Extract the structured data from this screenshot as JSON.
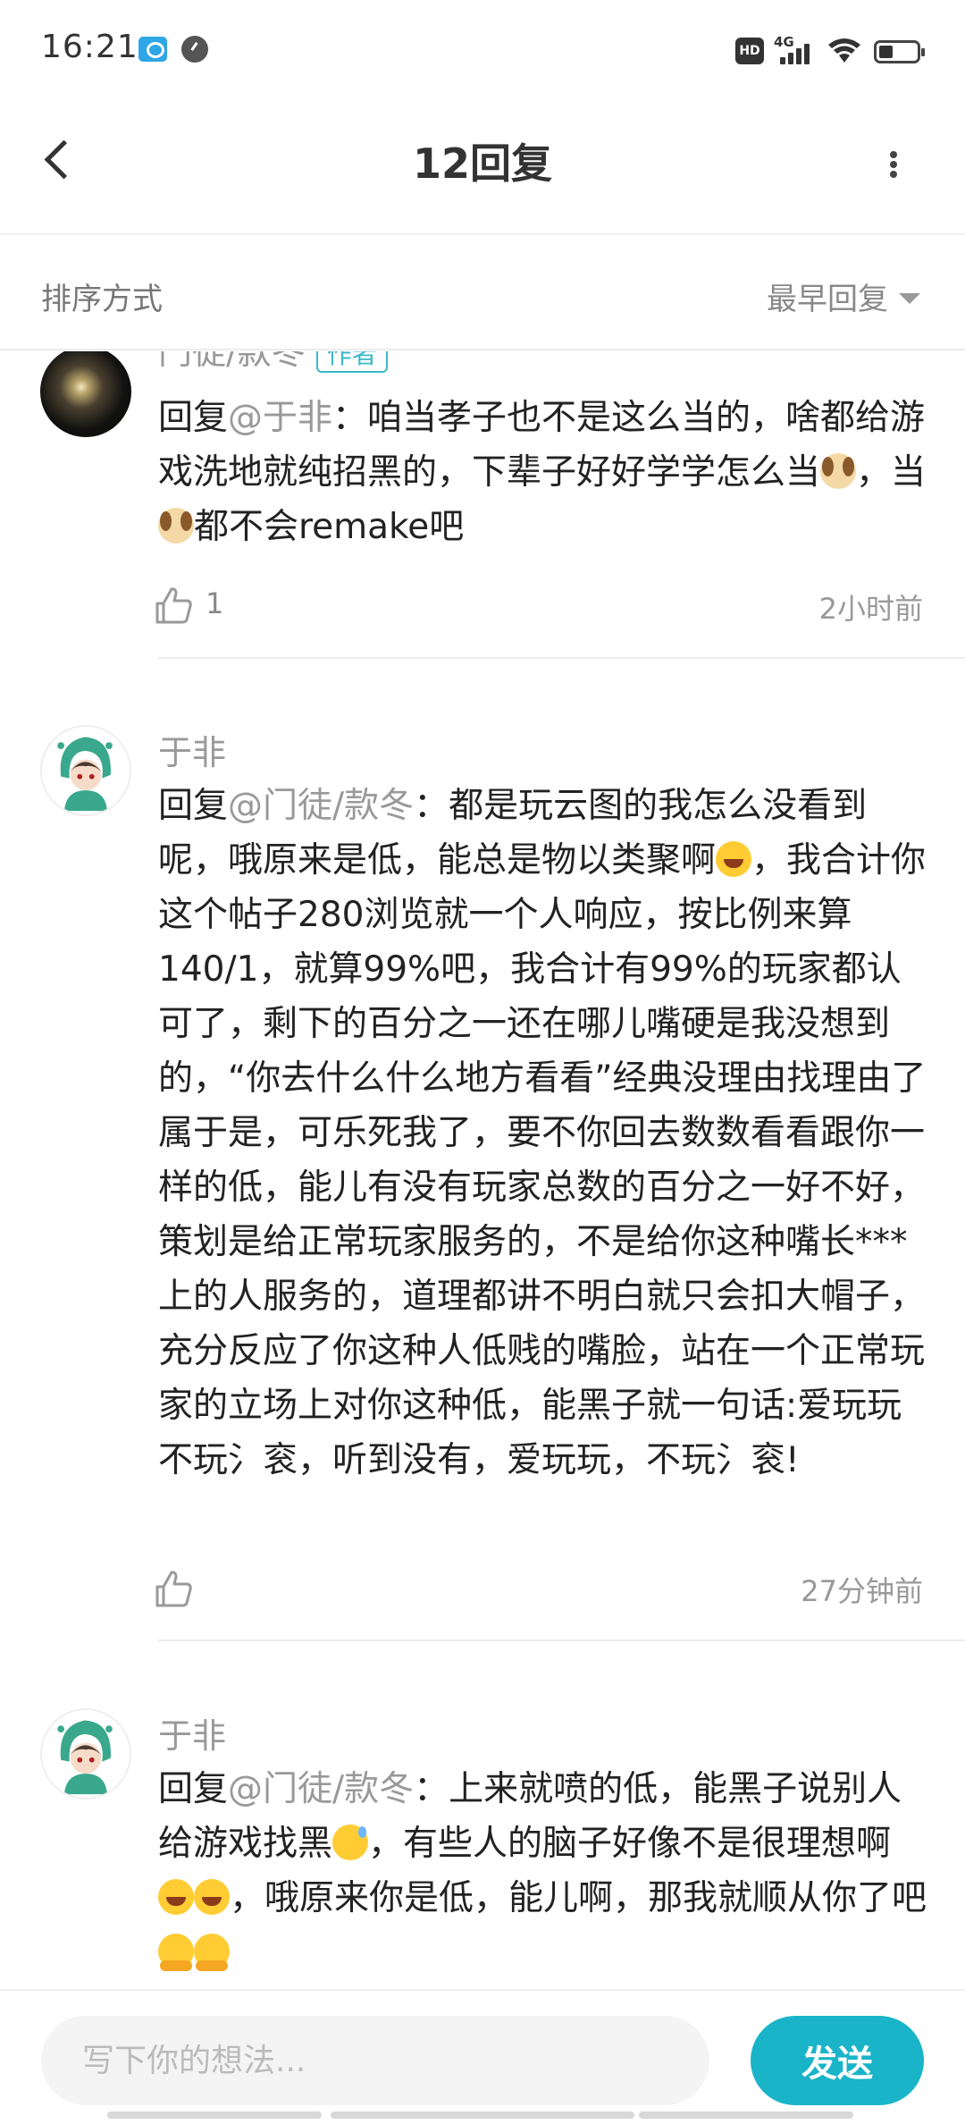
{
  "status_bar": {
    "time": "16:21",
    "network": "4G",
    "hd_label": "HD"
  },
  "header": {
    "title": "12回复"
  },
  "sort": {
    "label": "排序方式",
    "selected": "最早回复"
  },
  "comments": [
    {
      "username": "门徒/款冬",
      "badge": "作者",
      "reply_prefix": "回复",
      "mention": "@于非",
      "text_parts": [
        "：咱当孝子也不是这么当的，啥都给游戏洗地就纯招黑的，下辈子好好学学怎么当",
        "，当",
        "都不会remake吧"
      ],
      "likes": "1",
      "time": "2小时前"
    },
    {
      "username": "于非",
      "reply_prefix": "回复",
      "mention": "@门徒/款冬",
      "text_parts": [
        "：都是玩云图的我怎么没看到呢，哦原来是低，能总是物以类聚啊",
        "，我合计你这个帖子280浏览就一个人响应，按比例来算140/1，就算99%吧，我合计有99%的玩家都认可了，剩下的百分之一还在哪儿嘴硬是我没想到的，“你去什么什么地方看看”经典没理由找理由了属于是，可乐死我了，要不你回去数数看看跟你一样的低，能儿有没有玩家总数的百分之一好不好，策划是给正常玩家服务的，不是给你这种嘴长***上的人服务的，道理都讲不明白就只会扣大帽子，充分反应了你这种人低贱的嘴脸，站在一个正常玩家的立场上对你这种低，能黑子就一句话:爱玩玩不玩氵衮，听到没有，爱玩玩，不玩氵衮!"
      ],
      "likes": "",
      "time": "27分钟前"
    },
    {
      "username": "于非",
      "reply_prefix": "回复",
      "mention": "@门徒/款冬",
      "text_parts": [
        "：上来就喷的低，能黑子说别人给游戏找黑",
        "，有些人的脑子好像不是很理想啊",
        "，哦原来你是低，能儿啊，那我就顺从你了吧"
      ],
      "likes": "",
      "time": ""
    }
  ],
  "input": {
    "placeholder": "写下你的想法...",
    "send_label": "发送"
  },
  "colors": {
    "accent": "#1ab4c8",
    "muted": "#999999"
  }
}
